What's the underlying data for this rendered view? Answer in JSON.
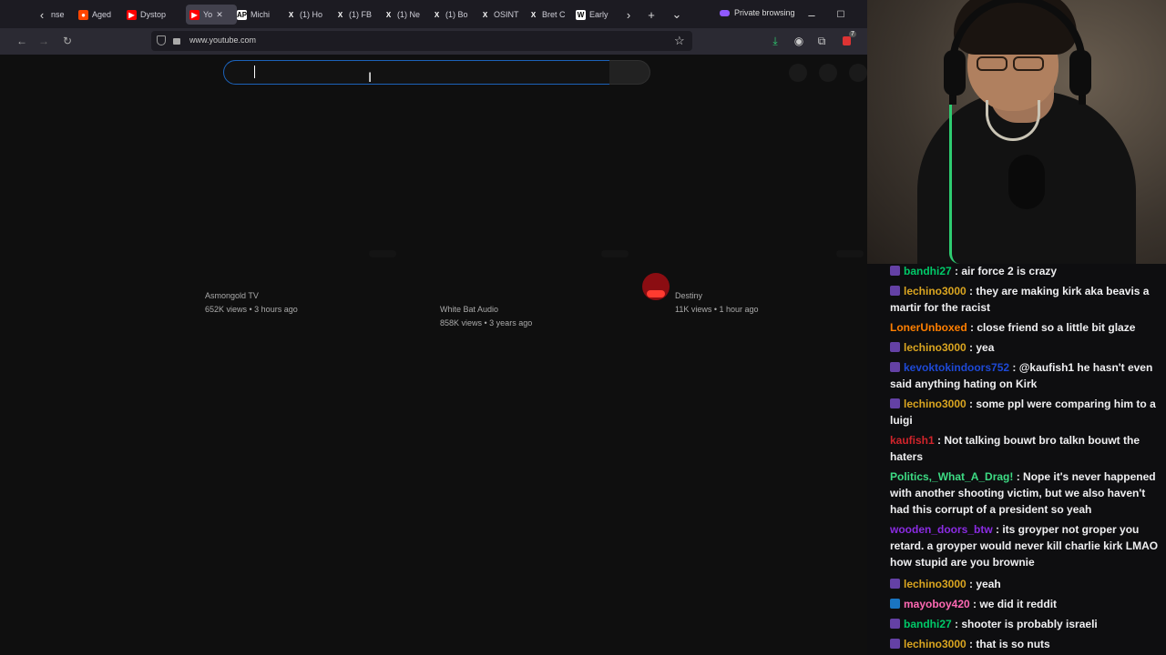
{
  "browser": {
    "tabs": [
      {
        "label": "nse",
        "fav": "",
        "fav_color": "#2b2a33"
      },
      {
        "label": "Aged",
        "fav": "●",
        "fav_color": "#ff4500"
      },
      {
        "label": "Dystop",
        "fav": "▶",
        "fav_color": "#ff0000"
      },
      {
        "label": "Yo",
        "fav": "▶",
        "fav_color": "#ff0000"
      },
      {
        "label": "Michi",
        "fav": "AP",
        "fav_color": "#ffffff"
      },
      {
        "label": "(1) Ho",
        "fav": "X",
        "fav_color": "#1c1b22"
      },
      {
        "label": "(1) FB",
        "fav": "X",
        "fav_color": "#1c1b22"
      },
      {
        "label": "(1) Ne",
        "fav": "X",
        "fav_color": "#1c1b22"
      },
      {
        "label": "(1) Bo",
        "fav": "X",
        "fav_color": "#1c1b22"
      },
      {
        "label": "OSINT",
        "fav": "X",
        "fav_color": "#1c1b22"
      },
      {
        "label": "Bret C",
        "fav": "X",
        "fav_color": "#1c1b22"
      },
      {
        "label": "Early",
        "fav": "W",
        "fav_color": "#ffffff"
      }
    ],
    "private_label": "Private browsing",
    "url": "www.youtube.com",
    "icons": {
      "back": "arrow-left-icon",
      "forward": "arrow-right-icon",
      "reload": "reload-icon",
      "shield": "shield-icon",
      "lock": "lock-icon",
      "bookmark": "star-icon",
      "download": "download-icon",
      "account": "account-icon",
      "extensions": "puzzle-icon"
    },
    "extension_badge": "7"
  },
  "youtube": {
    "videos": [
      {
        "channel": "Asmongold TV",
        "meta": "652K views • 3 hours ago"
      },
      {
        "channel": "White Bat Audio",
        "meta": "858K views • 3 years ago"
      },
      {
        "channel": "Destiny",
        "meta": "11K views • 1 hour ago"
      }
    ]
  },
  "chat": {
    "messages": [
      {
        "user": "bandhi27",
        "color": "#00c968",
        "text": " : air force 2 is crazy",
        "badge": true,
        "badge_color": "#6441a5"
      },
      {
        "user": "lechino3000",
        "color": "#daa520",
        "text": " : they are making kirk aka beavis a martir for the racist",
        "badge": true,
        "badge_color": "#6441a5"
      },
      {
        "user": "LonerUnboxed",
        "color": "#ff7f00",
        "text": " : close friend so a little bit glaze",
        "badge": false,
        "badge_color": ""
      },
      {
        "user": "lechino3000",
        "color": "#daa520",
        "text": " : yea",
        "badge": true,
        "badge_color": "#6441a5"
      },
      {
        "user": "kevoktokindoors752",
        "color": "#1e49d6",
        "text": " : @kaufish1 he hasn't even said anything hating on Kirk",
        "badge": true,
        "badge_color": "#6441a5"
      },
      {
        "user": "lechino3000",
        "color": "#daa520",
        "text": " : some ppl were comparing him to a luigi",
        "badge": true,
        "badge_color": "#6441a5"
      },
      {
        "user": "kaufish1",
        "color": "#d1242b",
        "text": " : Not talking bouwt bro talkn bouwt the haters",
        "badge": false,
        "badge_color": ""
      },
      {
        "user": "Politics,_What_A_Drag!",
        "color": "#3ddc84",
        "text": " : Nope it's never happened with another shooting victim, but we also haven't had this corrupt of a president so yeah",
        "badge": false,
        "badge_color": ""
      },
      {
        "user": "wooden_doors_btw",
        "color": "#8a2be2",
        "text": " : its groyper not groper you retard. a groyper would never kill charlie kirk LMAO how stupid are you brownie",
        "badge": false,
        "badge_color": ""
      },
      {
        "user": "lechino3000",
        "color": "#daa520",
        "text": " : yeah",
        "badge": true,
        "badge_color": "#6441a5"
      },
      {
        "user": "mayoboy420",
        "color": "#ff69b4",
        "text": " : we did it reddit",
        "badge": true,
        "badge_color": "#1a75c2"
      },
      {
        "user": "bandhi27",
        "color": "#00c968",
        "text": " : shooter is probably israeli",
        "badge": true,
        "badge_color": "#6441a5"
      },
      {
        "user": "lechino3000",
        "color": "#daa520",
        "text": " : that is so nuts",
        "badge": true,
        "badge_color": "#6441a5"
      }
    ]
  }
}
